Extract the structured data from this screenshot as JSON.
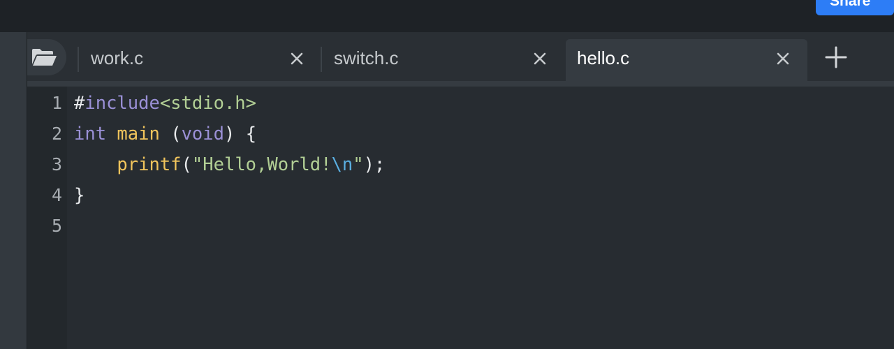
{
  "topbar": {
    "share_label": "Share"
  },
  "tabs": [
    {
      "label": "work.c",
      "active": false
    },
    {
      "label": "switch.c",
      "active": false
    },
    {
      "label": "hello.c",
      "active": true
    }
  ],
  "editor": {
    "line_numbers": [
      "1",
      "2",
      "3",
      "4",
      "5"
    ],
    "lines": [
      [
        {
          "t": "#",
          "c": "pl"
        },
        {
          "t": "include",
          "c": "kw"
        },
        {
          "t": "<stdio.h>",
          "c": "str"
        }
      ],
      [
        {
          "t": "int",
          "c": "kw"
        },
        {
          "t": " ",
          "c": "pl"
        },
        {
          "t": "main",
          "c": "fn"
        },
        {
          "t": " (",
          "c": "pl"
        },
        {
          "t": "void",
          "c": "kw"
        },
        {
          "t": ") {",
          "c": "pl"
        }
      ],
      [
        {
          "t": "    ",
          "c": "pl"
        },
        {
          "t": "printf",
          "c": "fn"
        },
        {
          "t": "(",
          "c": "pl"
        },
        {
          "t": "\"Hello,World!",
          "c": "str"
        },
        {
          "t": "\\n",
          "c": "esc"
        },
        {
          "t": "\"",
          "c": "str"
        },
        {
          "t": ");",
          "c": "pl"
        }
      ],
      [
        {
          "t": "}",
          "c": "pl"
        }
      ],
      []
    ]
  },
  "colors": {
    "accent": "#2d7df6",
    "keyword": "#9a90d6",
    "function": "#f0c45c",
    "string": "#b2cf95",
    "escape": "#5aaee0",
    "text": "#e8eaec"
  },
  "icons": {
    "open": "folder-open-icon",
    "close": "close-icon",
    "add": "plus-icon"
  }
}
